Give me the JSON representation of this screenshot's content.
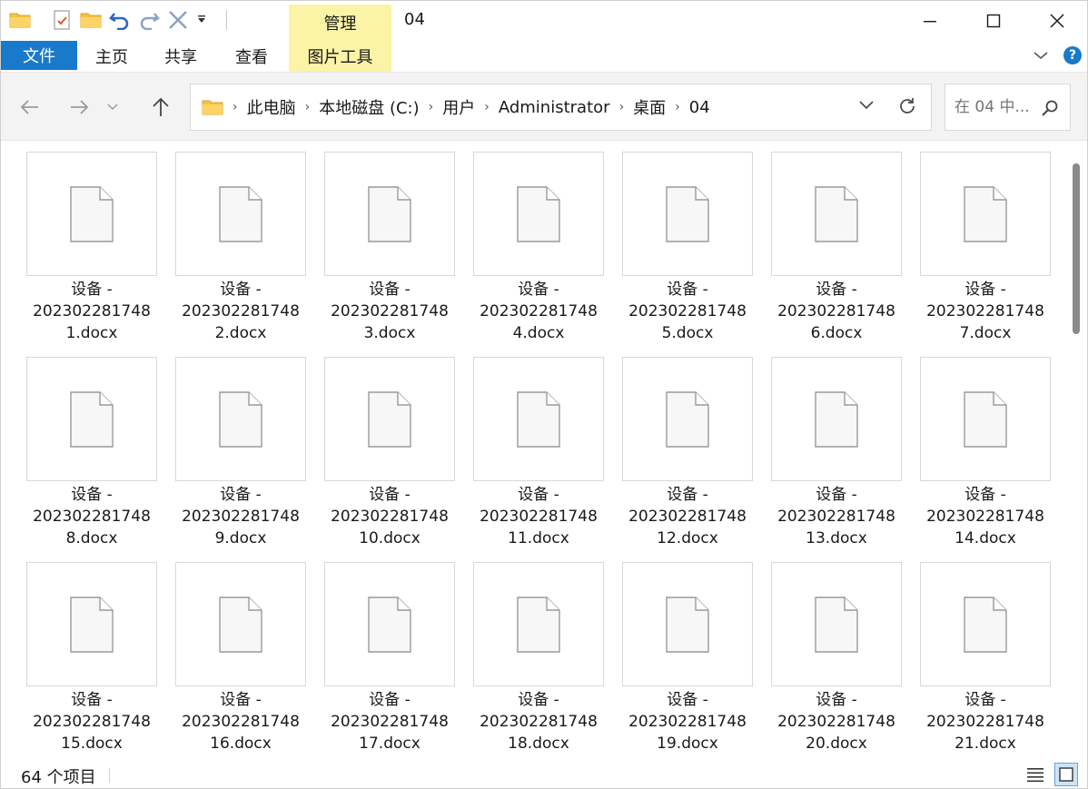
{
  "window": {
    "title": "04",
    "manage_tab": "管理",
    "controls": {
      "minimize": "minimize-icon",
      "maximize": "maximize-icon",
      "close": "close-icon"
    }
  },
  "ribbon": {
    "tabs": [
      {
        "label": "文件"
      },
      {
        "label": "主页"
      },
      {
        "label": "共享"
      },
      {
        "label": "查看"
      },
      {
        "label": "图片工具"
      }
    ],
    "help": "?"
  },
  "address": {
    "crumbs": [
      "此电脑",
      "本地磁盘 (C:)",
      "用户",
      "Administrator",
      "桌面",
      "04"
    ]
  },
  "search": {
    "placeholder": "在 04 中..."
  },
  "files": {
    "prefix": "设备 -",
    "items": [
      {
        "line2": "202302281748",
        "line3": "1.docx"
      },
      {
        "line2": "202302281748",
        "line3": "2.docx"
      },
      {
        "line2": "202302281748",
        "line3": "3.docx"
      },
      {
        "line2": "202302281748",
        "line3": "4.docx"
      },
      {
        "line2": "202302281748",
        "line3": "5.docx"
      },
      {
        "line2": "202302281748",
        "line3": "6.docx"
      },
      {
        "line2": "202302281748",
        "line3": "7.docx"
      },
      {
        "line2": "202302281748",
        "line3": "8.docx"
      },
      {
        "line2": "202302281748",
        "line3": "9.docx"
      },
      {
        "line2": "202302281748",
        "line3": "10.docx"
      },
      {
        "line2": "202302281748",
        "line3": "11.docx"
      },
      {
        "line2": "202302281748",
        "line3": "12.docx"
      },
      {
        "line2": "202302281748",
        "line3": "13.docx"
      },
      {
        "line2": "202302281748",
        "line3": "14.docx"
      },
      {
        "line2": "202302281748",
        "line3": "15.docx"
      },
      {
        "line2": "202302281748",
        "line3": "16.docx"
      },
      {
        "line2": "202302281748",
        "line3": "17.docx"
      },
      {
        "line2": "202302281748",
        "line3": "18.docx"
      },
      {
        "line2": "202302281748",
        "line3": "19.docx"
      },
      {
        "line2": "202302281748",
        "line3": "20.docx"
      },
      {
        "line2": "202302281748",
        "line3": "21.docx"
      }
    ]
  },
  "status": {
    "count": "64 个项目"
  }
}
